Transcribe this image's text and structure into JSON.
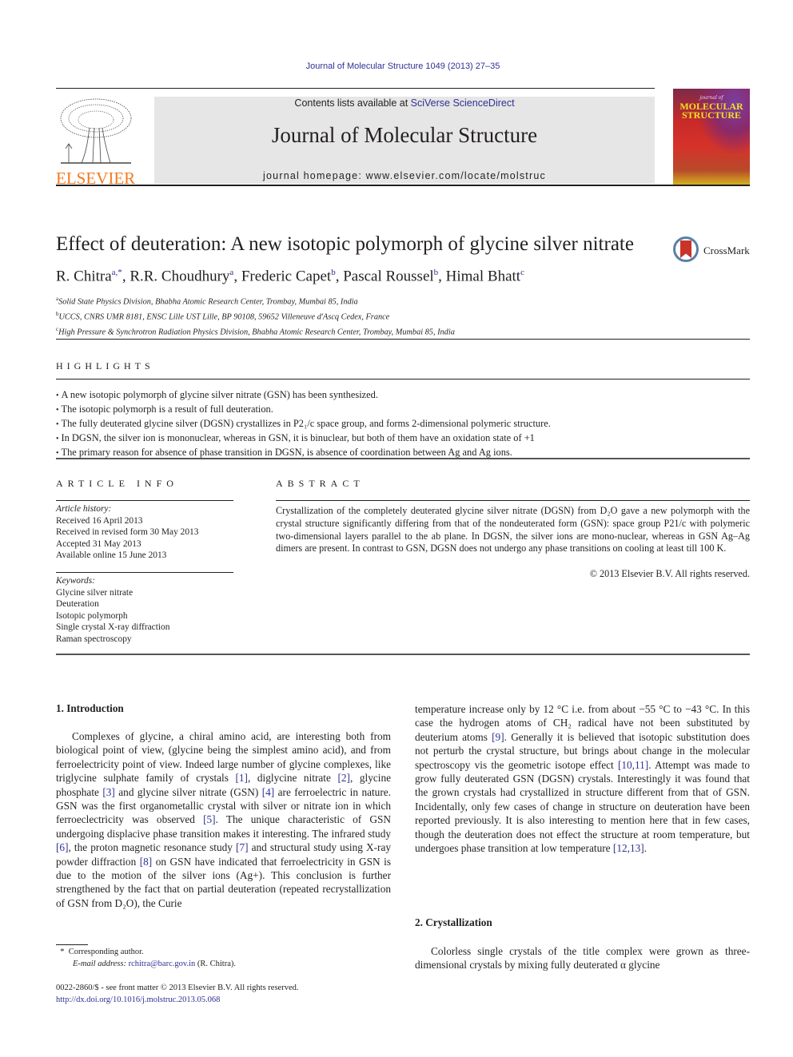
{
  "header": {
    "journal_reference": "Journal of Molecular Structure 1049 (2013) 27–35",
    "contents_prefix": "Contents lists available at ",
    "contents_link": "SciVerse ScienceDirect",
    "journal_title": "Journal of Molecular Structure",
    "homepage_prefix": "journal homepage: ",
    "homepage_url": "www.elsevier.com/locate/molstruc",
    "publisher_logo_text": "ELSEVIER",
    "cover_small_text": "journal of",
    "cover_title_line1": "MOLECULAR",
    "cover_title_line2": "STRUCTURE",
    "crossmark_label": "CrossMark"
  },
  "article": {
    "title": "Effect of deuteration: A new isotopic polymorph of glycine silver nitrate",
    "authors": [
      {
        "name": "R. Chitra",
        "sup": "a,*"
      },
      {
        "name": "R.R. Choudhury",
        "sup": "a"
      },
      {
        "name": "Frederic Capet",
        "sup": "b"
      },
      {
        "name": "Pascal Roussel",
        "sup": "b"
      },
      {
        "name": "Himal Bhatt",
        "sup": "c"
      }
    ],
    "affiliations": [
      {
        "key": "a",
        "text": "Solid State Physics Division, Bhabha Atomic Research Center, Trombay, Mumbai 85, India"
      },
      {
        "key": "b",
        "text": "UCCS, CNRS UMR 8181, ENSC Lille UST Lille, BP 90108, 59652 Villeneuve d'Ascq Cedex, France"
      },
      {
        "key": "c",
        "text": "High Pressure & Synchrotron Radiation Physics Division, Bhabha Atomic Research Center, Trombay, Mumbai 85, India"
      }
    ]
  },
  "highlights": {
    "label": "HIGHLIGHTS",
    "items": [
      "A new isotopic polymorph of glycine silver nitrate (GSN) has been synthesized.",
      "The isotopic polymorph is a result of full deuteration.",
      "The fully deuterated glycine silver (DGSN) crystallizes in P2₁/c space group, and forms 2-dimensional polymeric structure.",
      "In DGSN, the silver ion is mononuclear, whereas in GSN, it is binuclear, but both of them have an oxidation state of +1",
      "The primary reason for absence of phase transition in DGSN, is absence of coordination between Ag and Ag ions."
    ]
  },
  "article_info": {
    "label": "ARTICLE INFO",
    "history_label": "Article history:",
    "history": [
      "Received 16 April 2013",
      "Received in revised form 30 May 2013",
      "Accepted 31 May 2013",
      "Available online 15 June 2013"
    ],
    "keywords_label": "Keywords:",
    "keywords": [
      "Glycine silver nitrate",
      "Deuteration",
      "Isotopic polymorph",
      "Single crystal X-ray diffraction",
      "Raman spectroscopy"
    ]
  },
  "abstract": {
    "label": "ABSTRACT",
    "text": "Crystallization of the completely deuterated glycine silver nitrate (DGSN) from D₂O gave a new polymorph with the crystal structure significantly differing from that of the nondeuterated form (GSN): space group P21/c with polymeric two-dimensional layers parallel to the ab plane. In DGSN, the silver ions are mono-nuclear, whereas in GSN Ag–Ag dimers are present. In contrast to GSN, DGSN does not undergo any phase transitions on cooling at least till 100 K.",
    "copyright": "© 2013 Elsevier B.V. All rights reserved."
  },
  "sections": {
    "intro_heading": "1. Introduction",
    "intro_p1_parts": [
      "Complexes of glycine, a chiral amino acid, are interesting both from biological point of view, (glycine being the simplest amino acid), and from ferroelectricity point of view. Indeed large number of glycine complexes, like triglycine sulphate family of crystals ",
      "[1]",
      ", diglycine nitrate ",
      "[2]",
      ", glycine phosphate ",
      "[3]",
      " and glycine silver nitrate (GSN) ",
      "[4]",
      " are ferroelectric in nature. GSN was the first organometallic crystal with silver or nitrate ion in which ferroeclectricity was observed ",
      "[5]",
      ". The unique characteristic of GSN undergoing displacive phase transition makes it interesting. The infrared study ",
      "[6]",
      ", the proton magnetic resonance study ",
      "[7]",
      " and structural study using X-ray powder diffraction ",
      "[8]",
      " on GSN have indicated that ferroelectricity in GSN is due to the motion of the silver ions (Ag+). This conclusion is further strengthened by the fact that on partial deuteration (repeated recrystallization of GSN from D₂O), the Curie"
    ],
    "intro_p2_parts": [
      "temperature increase only by 12 °C i.e. from about −55 °C to −43 °C. In this case the hydrogen atoms of CH₂ radical have not been substituted by deuterium atoms ",
      "[9]",
      ". Generally it is believed that isotopic substitution does not perturb the crystal structure, but brings about change in the molecular spectroscopy vis the geometric isotope effect ",
      "[10,11]",
      ". Attempt was made to grow fully deuterated GSN (DGSN) crystals. Interestingly it was found that the grown crystals had crystallized in structure different from that of GSN. Incidentally, only few cases of change in structure on deuteration have been reported previously. It is also interesting to mention here that in few cases, though the deuteration does not effect the structure at room temperature, but undergoes phase transition at low temperature ",
      "[12,13]",
      "."
    ],
    "cryst_heading": "2. Crystallization",
    "cryst_p1": "Colorless single crystals of the title complex were grown as three-dimensional crystals by mixing fully deuterated α glycine"
  },
  "footnotes": {
    "corresponding": "Corresponding author.",
    "corresponding_mark": "*",
    "email_label": "E-mail address:",
    "email": "rchitra@barc.gov.in",
    "email_suffix": " (R. Chitra).",
    "issn_line": "0022-2860/$ - see front matter © 2013 Elsevier B.V. All rights reserved.",
    "doi": "http://dx.doi.org/10.1016/j.molstruc.2013.05.068"
  }
}
